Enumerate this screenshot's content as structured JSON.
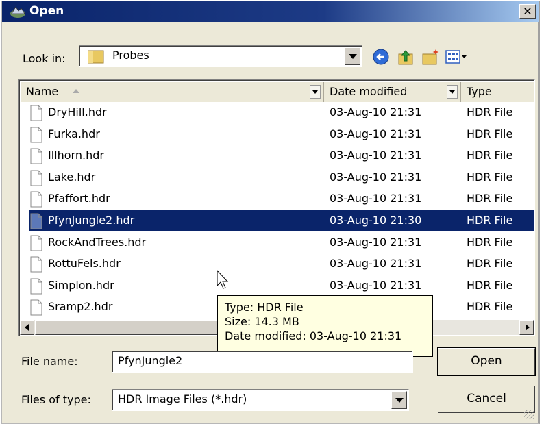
{
  "title": "Open",
  "close_glyph": "✕",
  "look_in": {
    "label": "Look in:",
    "value": "Probes",
    "icon": "folder-icon"
  },
  "toolbar": {
    "icons": [
      "back-icon",
      "up-folder-icon",
      "new-folder-icon",
      "view-menu-icon"
    ]
  },
  "columns": {
    "name": "Name",
    "date": "Date modified",
    "type": "Type"
  },
  "files": [
    {
      "name": "DryHill.hdr",
      "date": "03-Aug-10 21:31",
      "type": "HDR File"
    },
    {
      "name": "Furka.hdr",
      "date": "03-Aug-10 21:31",
      "type": "HDR File"
    },
    {
      "name": "Illhorn.hdr",
      "date": "03-Aug-10 21:31",
      "type": "HDR File"
    },
    {
      "name": "Lake.hdr",
      "date": "03-Aug-10 21:31",
      "type": "HDR File"
    },
    {
      "name": "Pfaffort.hdr",
      "date": "03-Aug-10 21:31",
      "type": "HDR File"
    },
    {
      "name": "PfynJungle2.hdr",
      "date": "03-Aug-10 21:30",
      "type": "HDR File",
      "selected": true
    },
    {
      "name": "RockAndTrees.hdr",
      "date": "03-Aug-10 21:31",
      "type": "HDR File"
    },
    {
      "name": "RottuFels.hdr",
      "date": "03-Aug-10 21:31",
      "type": "HDR File"
    },
    {
      "name": "Simplon.hdr",
      "date": "03-Aug-10 21:31",
      "type": "HDR File"
    },
    {
      "name": "Sramp2.hdr",
      "date": "",
      "type": "HDR File"
    }
  ],
  "tooltip": {
    "type": "Type: HDR File",
    "size": "Size: 14.3 MB",
    "date": "Date modified: 03-Aug-10 21:31"
  },
  "file_name": {
    "label": "File name:",
    "value": "PfynJungle2"
  },
  "files_of_type": {
    "label": "Files of type:",
    "value": "HDR Image Files (*.hdr)"
  },
  "buttons": {
    "open": "Open",
    "cancel": "Cancel"
  },
  "colors": {
    "selection": "#0a246a",
    "title_bar": "#0a246a",
    "tooltip_bg": "#ffffe1"
  }
}
